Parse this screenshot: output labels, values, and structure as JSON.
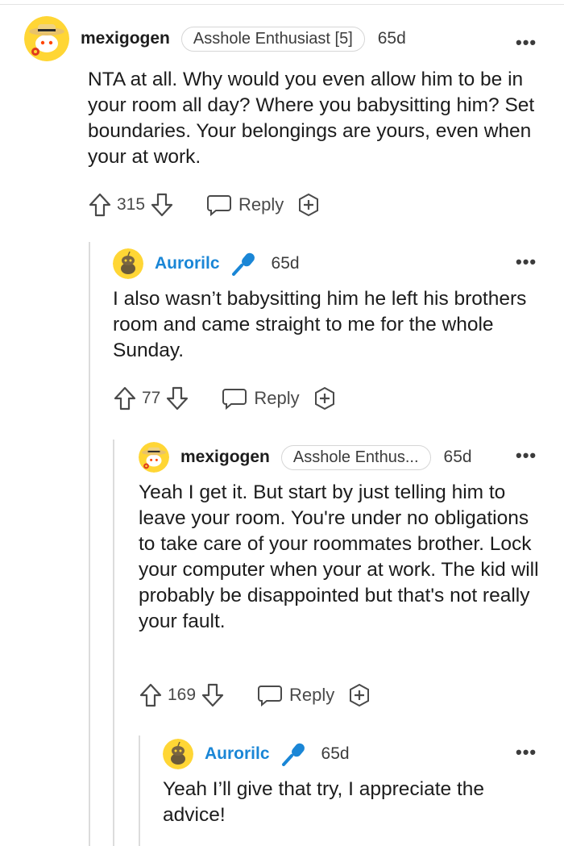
{
  "comments": [
    {
      "username": "mexigogen",
      "flair": "Asshole Enthusiast [5]",
      "age": "65d",
      "text": "NTA at all. Why would you even allow him to be in your room all day? Where you babysitting him? Set boundaries. Your belongings are yours, even when your at work.",
      "votes": "315",
      "reply_label": "Reply",
      "avatar_icon": "straw-hat-snoo-avatar"
    },
    {
      "username": "Aurorilc",
      "op_badge_icon": "microphone-icon",
      "age": "65d",
      "text": "I also wasn’t babysitting him he left his brothers room and came straight to me for the whole Sunday.",
      "votes": "77",
      "reply_label": "Reply",
      "avatar_icon": "yellow-snoo-avatar"
    },
    {
      "username": "mexigogen",
      "flair": "Asshole Enthus...",
      "age": "65d",
      "text": "Yeah I get it. But start by just telling him to leave your room. You're under no obligations to take care of your roommates brother. Lock your computer when your at work. The kid will probably be disappointed but that's not really your fault.",
      "votes": "169",
      "reply_label": "Reply",
      "avatar_icon": "straw-hat-snoo-avatar"
    },
    {
      "username": "Aurorilc",
      "op_badge_icon": "microphone-icon",
      "age": "65d",
      "text": "Yeah I’ll give that try, I appreciate the advice!",
      "avatar_icon": "yellow-snoo-avatar"
    }
  ],
  "more_glyph": "•••",
  "colors": {
    "op_name": "#1a86d6",
    "text": "#1c1c1c",
    "muted": "#4a4a4a",
    "rail": "#dcdcdc",
    "avatar_yellow": "#ffd635"
  }
}
